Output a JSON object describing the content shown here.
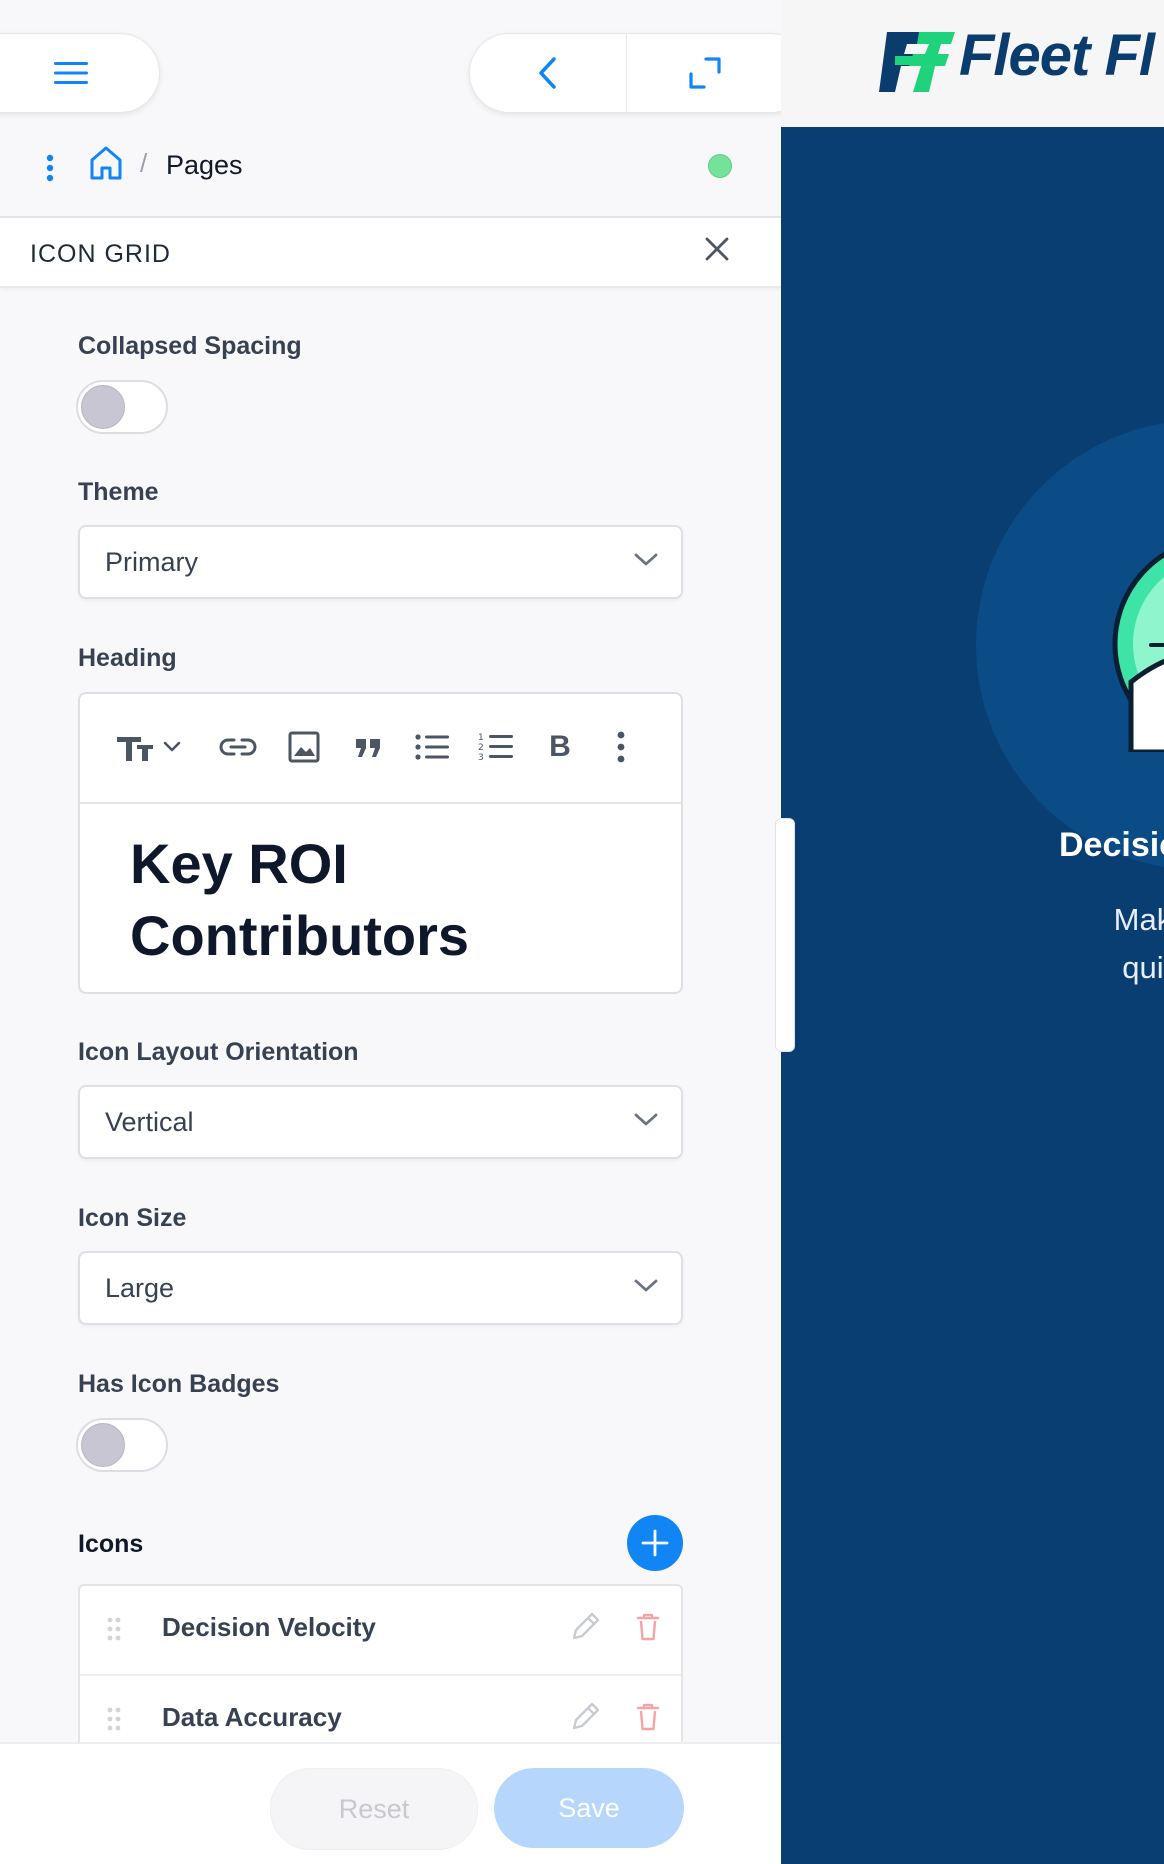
{
  "breadcrumb": {
    "separator": "/",
    "current": "Pages"
  },
  "section": {
    "title": "ICON GRID"
  },
  "fields": {
    "collapsed_spacing": {
      "label": "Collapsed Spacing",
      "on": false
    },
    "theme": {
      "label": "Theme",
      "value": "Primary"
    },
    "heading": {
      "label": "Heading",
      "line1": "Key ROI",
      "line2": "Contributors",
      "toolbar_icons": [
        "text-size-icon",
        "link-icon",
        "image-icon",
        "quote-icon",
        "bullet-list-icon",
        "numbered-list-icon",
        "bold-icon",
        "more-vertical-icon"
      ],
      "bold_glyph": "B"
    },
    "icon_layout_orientation": {
      "label": "Icon Layout Orientation",
      "value": "Vertical"
    },
    "icon_size": {
      "label": "Icon Size",
      "value": "Large"
    },
    "has_icon_badges": {
      "label": "Has Icon Badges",
      "on": false
    }
  },
  "icons": {
    "label": "Icons",
    "items": [
      {
        "label": "Decision Velocity"
      },
      {
        "label": "Data Accuracy"
      }
    ]
  },
  "footer": {
    "reset_label": "Reset",
    "save_label": "Save"
  },
  "preview": {
    "logo_text": "Fleet Fl",
    "card_title": "Decisio",
    "card_desc_line1": "Make an impo",
    "card_desc_line2": "quickly with r"
  },
  "colors": {
    "accent": "#1185f3",
    "preview_bg": "#093e73",
    "status_green": "#74e29a",
    "brand_green": "#1fd27c"
  }
}
